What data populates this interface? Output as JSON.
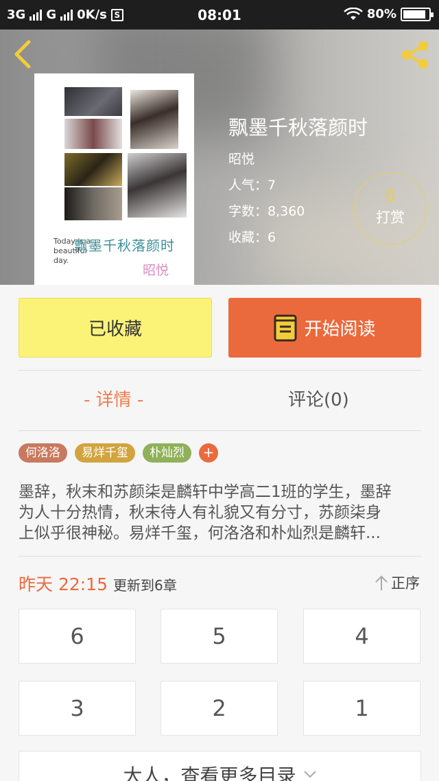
{
  "status_bar": {
    "network1": "3G",
    "network2": "G",
    "speed": "0K/s",
    "sim_badge": "S",
    "time": "08:01",
    "battery": "80%"
  },
  "book": {
    "title": "飘墨千秋落颜时",
    "author": "昭悦",
    "popularity": "人气：7",
    "word_count": "字数：8,360",
    "favorites": "收藏：6",
    "tip_count": "0",
    "tip_label": "打赏",
    "cover": {
      "caption_en": "Today is a beautiful day.",
      "caption_title": "飘墨千秋落颜时",
      "caption_author": "昭悦"
    }
  },
  "actions": {
    "favorited_label": "已收藏",
    "read_label": "开始阅读"
  },
  "tabs": [
    {
      "label": "- 详情 -",
      "active": true
    },
    {
      "label": "评论(0)",
      "active": false
    }
  ],
  "tags": [
    {
      "label": "何洛洛",
      "color": "#c9795f"
    },
    {
      "label": "易烊千玺",
      "color": "#d2a43f"
    },
    {
      "label": "朴灿烈",
      "color": "#8fb15a"
    }
  ],
  "tag_add": "+",
  "description": {
    "line1": "墨辞，秋末和苏颜柒是麟轩中学高二1班的学生，墨辞",
    "line2": "为人十分热情，秋末待人有礼貌又有分寸，苏颜柒身",
    "line3": "上似乎很神秘。易烊千玺，何洛洛和朴灿烈是麟轩..."
  },
  "update": {
    "time": "昨天 22:15",
    "info": "更新到6章",
    "sort_label": "正序"
  },
  "chapters": [
    "6",
    "5",
    "4",
    "3",
    "2",
    "1"
  ],
  "more_catalog": "大人，查看更多目录",
  "colors": {
    "accent": "#ea6a3e",
    "favorite_bg": "#fbf378",
    "icon_yellow": "#f3cc3c"
  }
}
